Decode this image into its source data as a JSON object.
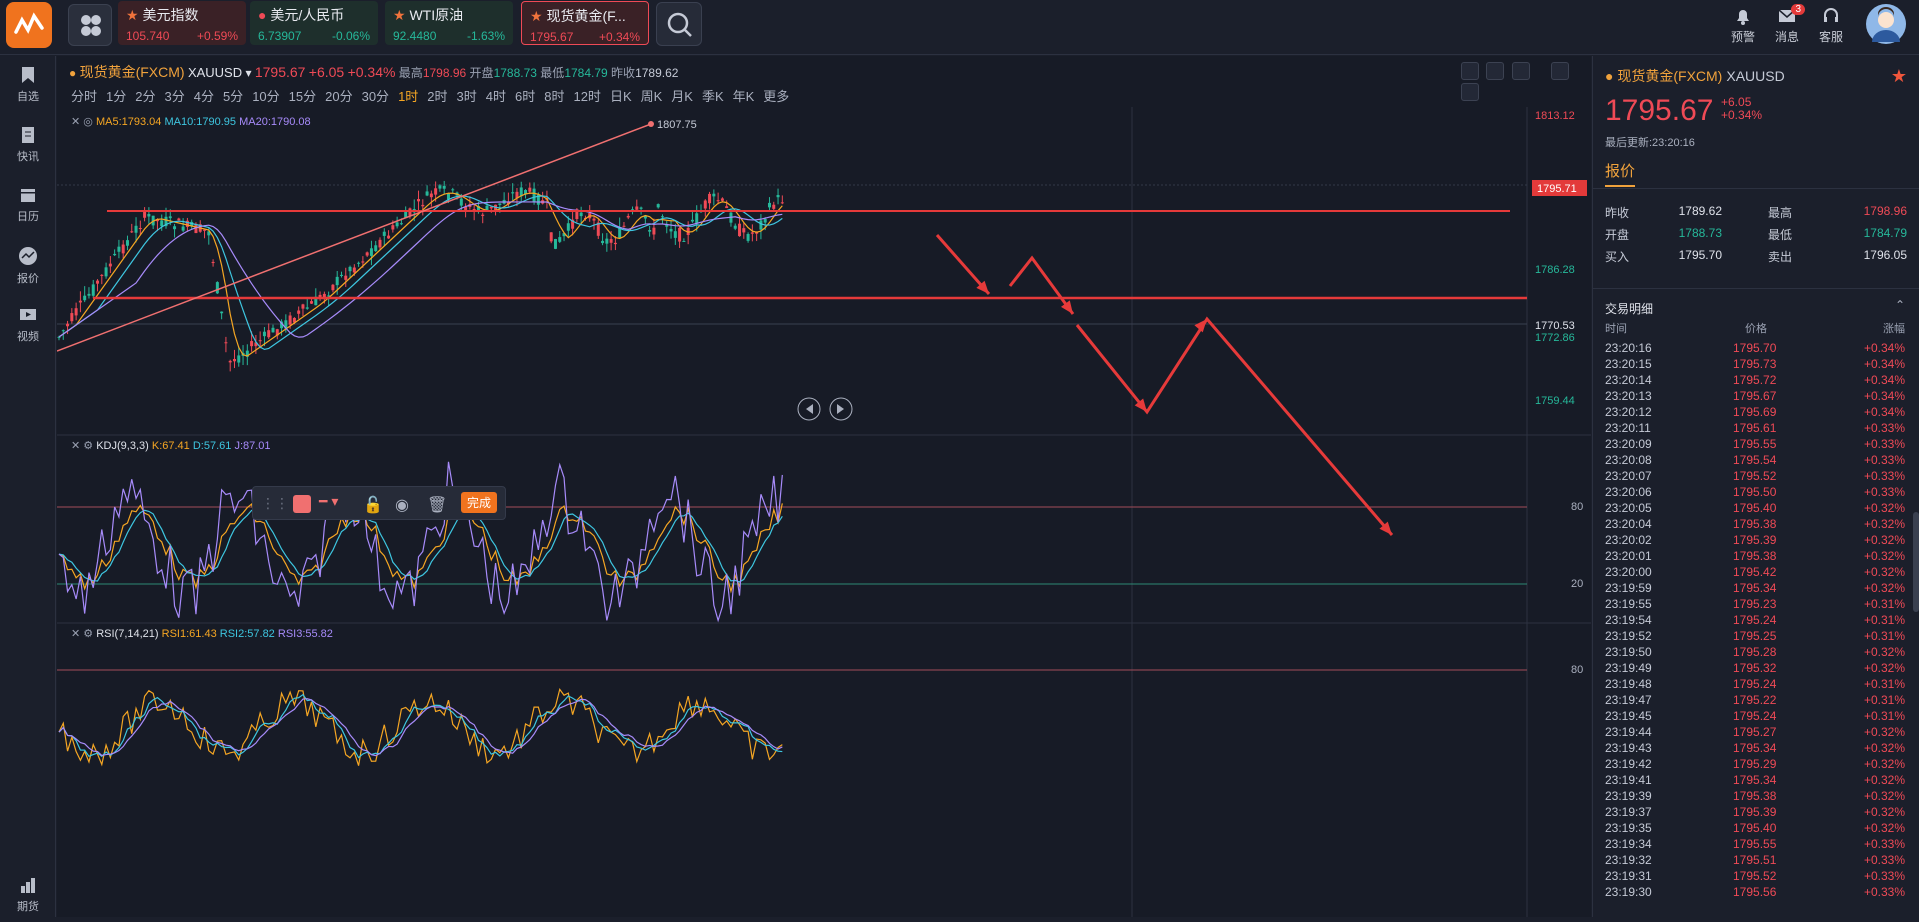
{
  "topbar": {
    "tickers": [
      {
        "name": "美元指数",
        "price": "105.740",
        "change": "+0.59%",
        "dir": "up"
      },
      {
        "name": "美元/人民币",
        "price": "6.73907",
        "change": "-0.06%",
        "dir": "down"
      },
      {
        "name": "WTI原油",
        "price": "92.4480",
        "change": "-1.63%",
        "dir": "down"
      },
      {
        "name": "现货黄金(F...",
        "price": "1795.67",
        "change": "+0.34%",
        "dir": "up"
      }
    ],
    "alert_label": "预警",
    "message_label": "消息",
    "message_badge": "3",
    "service_label": "客服"
  },
  "sidebar": {
    "items": [
      {
        "label": "自选",
        "icon": "bookmark-icon"
      },
      {
        "label": "快讯",
        "icon": "document-icon"
      },
      {
        "label": "日历",
        "icon": "calendar-icon"
      },
      {
        "label": "报价",
        "icon": "quote-icon"
      },
      {
        "label": "视频",
        "icon": "video-icon"
      }
    ],
    "bottom_label": "期货"
  },
  "main": {
    "symbol": "现货黄金(FXCM)",
    "code": "XAUUSD",
    "price": "1795.67",
    "change": "+6.05",
    "change_pct": "+0.34%",
    "high_label": "最高",
    "high": "1798.96",
    "open_label": "开盘",
    "open": "1788.73",
    "low_label": "最低",
    "low": "1784.79",
    "prev_label": "昨收",
    "prev": "1789.62",
    "periods": [
      "分时",
      "1分",
      "2分",
      "3分",
      "4分",
      "5分",
      "10分",
      "15分",
      "20分",
      "30分",
      "1时",
      "2时",
      "3时",
      "4时",
      "6时",
      "8时",
      "12时",
      "日K",
      "周K",
      "月K",
      "季K",
      "年K",
      "更多"
    ],
    "active_period": "1时",
    "ma_label": "MA5:1793.04",
    "ma10_label": "MA10:1790.95",
    "ma20_label": "MA20:1790.08",
    "kdj_label": "KDJ(9,3,3)",
    "kdj_k": "K:67.41",
    "kdj_d": "D:57.61",
    "kdj_j": "J:87.01",
    "rsi_label": "RSI(7,14,21)",
    "rsi1": "RSI1:61.43",
    "rsi2": "RSI2:57.82",
    "rsi3": "RSI3:55.82",
    "price_axis": [
      "1813.12",
      "1799.70",
      "1786.28",
      "1772.86",
      "1759.44"
    ],
    "price_tag": "1795.71",
    "price_tag2": "1770.53",
    "peak_label": "1807.75",
    "kdj_axis": [
      "80",
      "20"
    ],
    "rsi_axis": [
      "80"
    ],
    "done_label": "完成",
    "colors": {
      "up": "#ef4a56",
      "down": "#26b89a",
      "ma5": "#f5a623",
      "ma10": "#3ec6e0",
      "ma20": "#a78bfa",
      "annot": "#e63a3a"
    }
  },
  "right": {
    "title": "现货黄金(FXCM)",
    "code": "XAUUSD",
    "price": "1795.67",
    "change": "+6.05",
    "change_pct": "+0.34%",
    "updated": "最后更新:23:20:16",
    "tab": "报价",
    "quotes": [
      {
        "l1": "昨收",
        "v1": "1789.62",
        "c1": "#dfe2ea",
        "l2": "最高",
        "v2": "1798.96",
        "c2": "#ef4a56"
      },
      {
        "l1": "开盘",
        "v1": "1788.73",
        "c1": "#26b89a",
        "l2": "最低",
        "v2": "1784.79",
        "c2": "#26b89a"
      },
      {
        "l1": "买入",
        "v1": "1795.70",
        "c1": "#dfe2ea",
        "l2": "卖出",
        "v2": "1796.05",
        "c2": "#dfe2ea"
      }
    ],
    "trade_header": "交易明细",
    "cols": [
      "时间",
      "价格",
      "涨幅"
    ],
    "trades": [
      [
        "23:20:16",
        "1795.70",
        "+0.34%"
      ],
      [
        "23:20:15",
        "1795.73",
        "+0.34%"
      ],
      [
        "23:20:14",
        "1795.72",
        "+0.34%"
      ],
      [
        "23:20:13",
        "1795.67",
        "+0.34%"
      ],
      [
        "23:20:12",
        "1795.69",
        "+0.34%"
      ],
      [
        "23:20:11",
        "1795.61",
        "+0.33%"
      ],
      [
        "23:20:09",
        "1795.55",
        "+0.33%"
      ],
      [
        "23:20:08",
        "1795.54",
        "+0.33%"
      ],
      [
        "23:20:07",
        "1795.52",
        "+0.33%"
      ],
      [
        "23:20:06",
        "1795.50",
        "+0.33%"
      ],
      [
        "23:20:05",
        "1795.40",
        "+0.32%"
      ],
      [
        "23:20:04",
        "1795.38",
        "+0.32%"
      ],
      [
        "23:20:02",
        "1795.39",
        "+0.32%"
      ],
      [
        "23:20:01",
        "1795.38",
        "+0.32%"
      ],
      [
        "23:20:00",
        "1795.42",
        "+0.32%"
      ],
      [
        "23:19:59",
        "1795.34",
        "+0.32%"
      ],
      [
        "23:19:55",
        "1795.23",
        "+0.31%"
      ],
      [
        "23:19:54",
        "1795.24",
        "+0.31%"
      ],
      [
        "23:19:52",
        "1795.25",
        "+0.31%"
      ],
      [
        "23:19:50",
        "1795.28",
        "+0.32%"
      ],
      [
        "23:19:49",
        "1795.32",
        "+0.32%"
      ],
      [
        "23:19:48",
        "1795.24",
        "+0.31%"
      ],
      [
        "23:19:47",
        "1795.22",
        "+0.31%"
      ],
      [
        "23:19:45",
        "1795.24",
        "+0.31%"
      ],
      [
        "23:19:44",
        "1795.27",
        "+0.32%"
      ],
      [
        "23:19:43",
        "1795.34",
        "+0.32%"
      ],
      [
        "23:19:42",
        "1795.29",
        "+0.32%"
      ],
      [
        "23:19:41",
        "1795.34",
        "+0.32%"
      ],
      [
        "23:19:39",
        "1795.38",
        "+0.32%"
      ],
      [
        "23:19:37",
        "1795.39",
        "+0.32%"
      ],
      [
        "23:19:35",
        "1795.40",
        "+0.32%"
      ],
      [
        "23:19:34",
        "1795.55",
        "+0.33%"
      ],
      [
        "23:19:32",
        "1795.51",
        "+0.33%"
      ],
      [
        "23:19:31",
        "1795.52",
        "+0.33%"
      ],
      [
        "23:19:30",
        "1795.56",
        "+0.33%"
      ]
    ]
  }
}
